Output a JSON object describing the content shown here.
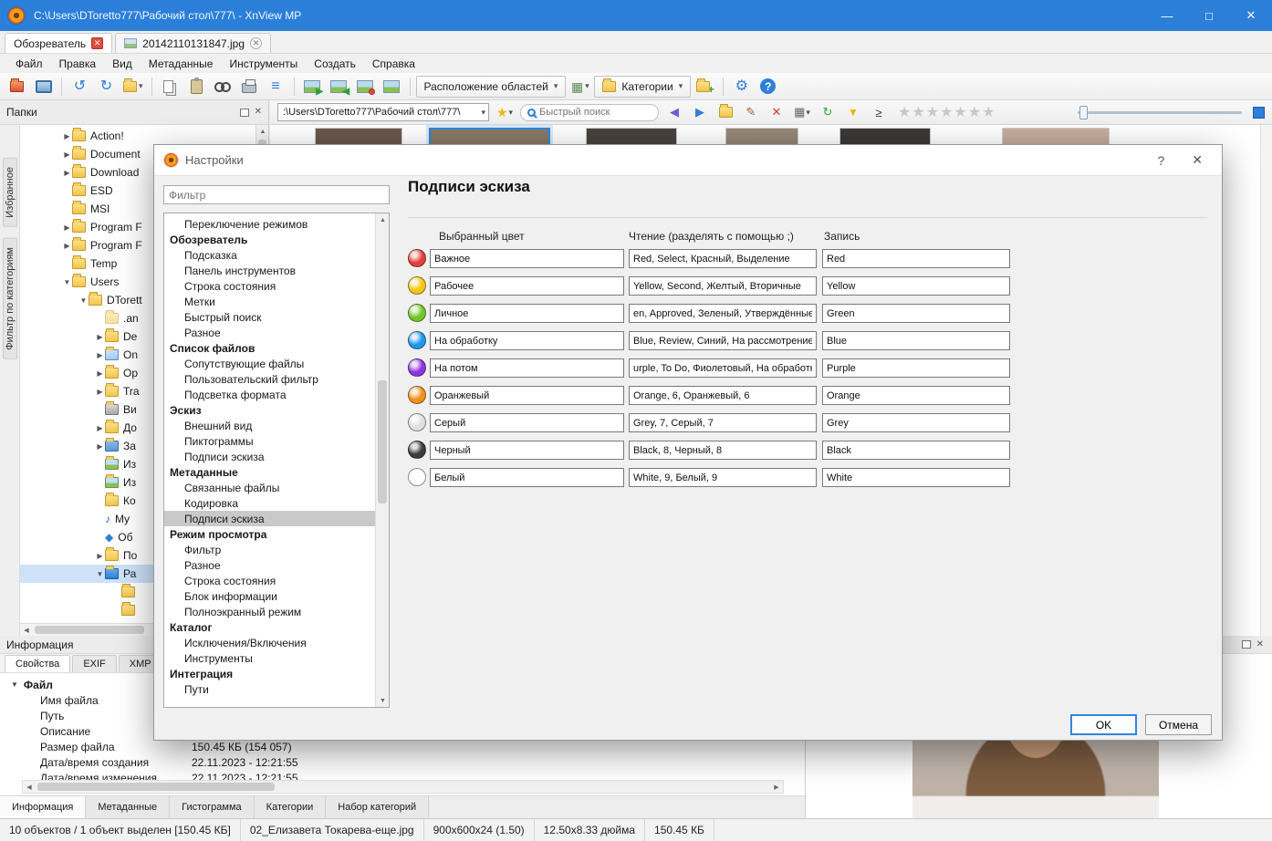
{
  "window": {
    "title": "C:\\Users\\DToretto777\\Рабочий стол\\777\\ - XnView MP"
  },
  "icons": {
    "minimize": "—",
    "maximize": "□",
    "close": "✕",
    "question": "?",
    "collapsed": "▶",
    "expanded": "▼",
    "dropdown": "▾",
    "undo": "↺",
    "redo": "↻",
    "up": "▲",
    "down": "▼",
    "left": "◀",
    "right": "▶",
    "star": "★",
    "pencil": "✎",
    "menu": "≡",
    "sort": "≥",
    "gear": "⚙",
    "grid": "▦",
    "music": "♪",
    "cube": "◆",
    "plus": "+"
  },
  "doc_tabs": [
    {
      "label": "Обозреватель"
    },
    {
      "label": "20142110131847.jpg"
    }
  ],
  "menu": {
    "items": [
      "Файл",
      "Правка",
      "Вид",
      "Метаданные",
      "Инструменты",
      "Создать",
      "Справка"
    ]
  },
  "toolbar": {
    "areas_label": "Расположение областей",
    "categories_label": "Категории"
  },
  "addressbar": {
    "path": ":\\Users\\DToretto777\\Рабочий стол\\777\\",
    "search_placeholder": "Быстрый поиск"
  },
  "folders": {
    "title": "Папки",
    "side_tabs": [
      "Избранное",
      "Фильтр по категориям"
    ],
    "items": [
      {
        "label": "Action!",
        "level": 1,
        "expand": "collapsed",
        "icon": "folder"
      },
      {
        "label": "Document",
        "level": 1,
        "expand": "collapsed",
        "icon": "folder"
      },
      {
        "label": "Download",
        "level": 1,
        "expand": "collapsed",
        "icon": "folder"
      },
      {
        "label": "ESD",
        "level": 1,
        "expand": "none",
        "icon": "folder"
      },
      {
        "label": "MSI",
        "level": 1,
        "expand": "none",
        "icon": "folder"
      },
      {
        "label": "Program F",
        "level": 1,
        "expand": "collapsed",
        "icon": "folder"
      },
      {
        "label": "Program F",
        "level": 1,
        "expand": "collapsed",
        "icon": "folder"
      },
      {
        "label": "Temp",
        "level": 1,
        "expand": "none",
        "icon": "folder"
      },
      {
        "label": "Users",
        "level": 1,
        "expand": "expanded",
        "icon": "folder"
      },
      {
        "label": "DTorett",
        "level": 2,
        "expand": "expanded",
        "icon": "folder"
      },
      {
        "label": ".an",
        "level": 3,
        "expand": "none",
        "icon": "folder-hidden"
      },
      {
        "label": "De",
        "level": 3,
        "expand": "collapsed",
        "icon": "folder"
      },
      {
        "label": "On",
        "level": 3,
        "expand": "collapsed",
        "icon": "folder-cloud"
      },
      {
        "label": "Op",
        "level": 3,
        "expand": "collapsed",
        "icon": "folder"
      },
      {
        "label": "Tra",
        "level": 3,
        "expand": "collapsed",
        "icon": "folder"
      },
      {
        "label": "Ви",
        "level": 3,
        "expand": "none",
        "icon": "folder-video"
      },
      {
        "label": "До",
        "level": 3,
        "expand": "collapsed",
        "icon": "folder-docs"
      },
      {
        "label": "За",
        "level": 3,
        "expand": "collapsed",
        "icon": "folder-download"
      },
      {
        "label": "Из",
        "level": 3,
        "expand": "none",
        "icon": "folder-image"
      },
      {
        "label": "Из",
        "level": 3,
        "expand": "none",
        "icon": "folder-image"
      },
      {
        "label": "Ко",
        "level": 3,
        "expand": "none",
        "icon": "folder-contacts"
      },
      {
        "label": "My",
        "level": 3,
        "expand": "none",
        "icon": "folder-music"
      },
      {
        "label": "Об",
        "level": 3,
        "expand": "none",
        "icon": "objects-3d"
      },
      {
        "label": "По",
        "level": 3,
        "expand": "collapsed",
        "icon": "folder-search"
      },
      {
        "label": "Ра",
        "level": 3,
        "expand": "expanded",
        "icon": "desktop",
        "selected": true
      },
      {
        "label": "",
        "level": 4,
        "expand": "none",
        "icon": "folder"
      },
      {
        "label": "",
        "level": 4,
        "expand": "none",
        "icon": "folder"
      }
    ]
  },
  "dialog": {
    "title": "Настройки",
    "filter_placeholder": "Фильтр",
    "page_title": "Подписи эскиза",
    "columns": [
      "Выбранный цвет",
      "Чтение (разделять с помощью ;)",
      "Запись"
    ],
    "tree": [
      {
        "label": "Переключение режимов",
        "level": 1
      },
      {
        "label": "Обозреватель",
        "level": 0
      },
      {
        "label": "Подсказка",
        "level": 1
      },
      {
        "label": "Панель инструментов",
        "level": 1
      },
      {
        "label": "Строка состояния",
        "level": 1
      },
      {
        "label": "Метки",
        "level": 1
      },
      {
        "label": "Быстрый поиск",
        "level": 1
      },
      {
        "label": "Разное",
        "level": 1
      },
      {
        "label": "Список файлов",
        "level": 0
      },
      {
        "label": "Сопутствующие файлы",
        "level": 1
      },
      {
        "label": "Пользовательский фильтр",
        "level": 1
      },
      {
        "label": "Подсветка формата",
        "level": 1
      },
      {
        "label": "Эскиз",
        "level": 0
      },
      {
        "label": "Внешний вид",
        "level": 1
      },
      {
        "label": "Пиктограммы",
        "level": 1
      },
      {
        "label": "Подписи эскиза",
        "level": 1
      },
      {
        "label": "Метаданные",
        "level": 0
      },
      {
        "label": "Связанные файлы",
        "level": 1
      },
      {
        "label": "Кодировка",
        "level": 1
      },
      {
        "label": "Подписи эскиза",
        "level": 1,
        "selected": true
      },
      {
        "label": "Режим просмотра",
        "level": 0
      },
      {
        "label": "Фильтр",
        "level": 1
      },
      {
        "label": "Разное",
        "level": 1
      },
      {
        "label": "Строка состояния",
        "level": 1
      },
      {
        "label": "Блок информации",
        "level": 1
      },
      {
        "label": "Полноэкранный режим",
        "level": 1
      },
      {
        "label": "Каталог",
        "level": 0
      },
      {
        "label": "Исключения/Включения",
        "level": 1
      },
      {
        "label": "Инструменты",
        "level": 1
      },
      {
        "label": "Интеграция",
        "level": 0
      },
      {
        "label": "Пути",
        "level": 1
      }
    ],
    "rows": [
      {
        "name": "red",
        "color": "#e0413c",
        "label": "Важное",
        "read": "Red, Select, Красный, Выделение",
        "write": "Red"
      },
      {
        "name": "yellow",
        "color": "#f2c715",
        "label": "Рабочее",
        "read": "Yellow, Second, Желтый, Вторичные",
        "write": "Yellow"
      },
      {
        "name": "green",
        "color": "#74c52c",
        "label": "Личное",
        "read": "en, Approved, Зеленый, Утверждённые",
        "write": "Green"
      },
      {
        "name": "blue",
        "color": "#1f97ee",
        "label": "На обработку",
        "read": "Blue, Review, Синий, На рассмотрение",
        "write": "Blue"
      },
      {
        "name": "purple",
        "color": "#8f35e0",
        "label": "На потом",
        "read": "urple, To Do, Фиолетовый, На обработку",
        "write": "Purple"
      },
      {
        "name": "orange",
        "color": "#f1901d",
        "label": "Оранжевый",
        "read": "Orange, 6, Оранжевый, 6",
        "write": "Orange"
      },
      {
        "name": "grey",
        "color": "#e0e0e0",
        "label": "Серый",
        "read": "Grey, 7, Серый, 7",
        "write": "Grey"
      },
      {
        "name": "black",
        "color": "#3d3d3d",
        "label": "Черный",
        "read": "Black, 8, Черный, 8",
        "write": "Black"
      },
      {
        "name": "white",
        "color": "#ffffff",
        "label": "Белый",
        "read": "White, 9, Белый, 9",
        "write": "White"
      }
    ],
    "ok": "OK",
    "cancel": "Отмена"
  },
  "info": {
    "title": "Информация",
    "tabs": [
      "Свойства",
      "EXIF",
      "XMP"
    ],
    "rows": [
      {
        "label": "Файл",
        "value": "",
        "bold": true
      },
      {
        "label": "Имя файла",
        "value": ""
      },
      {
        "label": "Путь",
        "value": ""
      },
      {
        "label": "Описание",
        "value": ""
      },
      {
        "label": "Размер файла",
        "value": "150.45 КБ (154 057)"
      },
      {
        "label": "Дата/время создания",
        "value": "22.11.2023 - 12:21:55"
      },
      {
        "label": "Дата/время изменения",
        "value": "22.11.2023 - 12:21:55"
      }
    ],
    "bottom_tabs": [
      "Информация",
      "Метаданные",
      "Гистограмма",
      "Категории",
      "Набор категорий"
    ]
  },
  "status": {
    "cells": [
      "10 объектов / 1 объект выделен [150.45 КБ]",
      "02_Елизавета Токарева-еще.jpg",
      "900x600x24 (1.50)",
      "12.50x8.33 дюйма",
      "150.45 КБ"
    ]
  }
}
